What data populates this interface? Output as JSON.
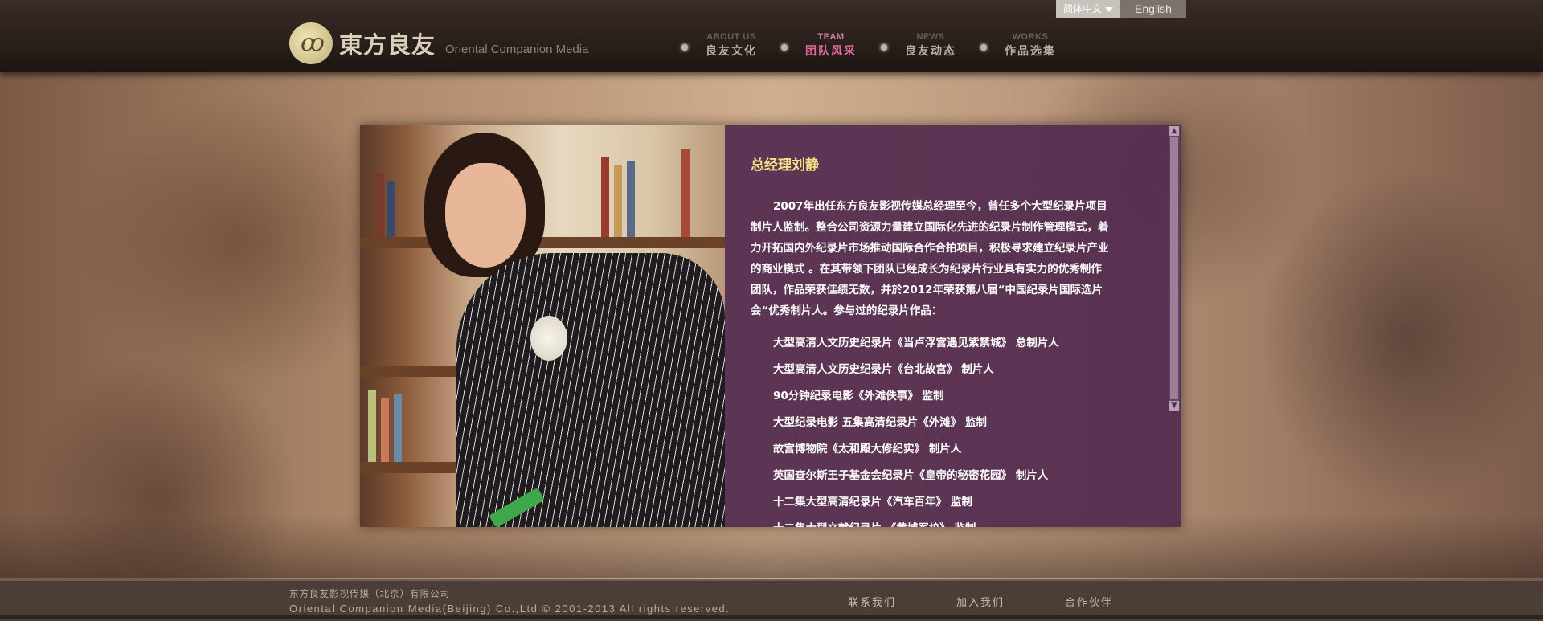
{
  "header": {
    "logo_cn": "東方良友",
    "logo_en": "Oriental Companion Media",
    "lang": {
      "chinese": "简体中文",
      "english": "English"
    },
    "nav": [
      {
        "en": "ABOUT US",
        "cn": "良友文化"
      },
      {
        "en": "TEAM",
        "cn": "团队风采"
      },
      {
        "en": "NEWS",
        "cn": "良友动态"
      },
      {
        "en": "WORKS",
        "cn": "作品选集"
      }
    ]
  },
  "profile": {
    "title": "总经理刘静",
    "intro": "2007年出任东方良友影视传媒总经理至今，曾任多个大型纪录片项目制片人监制。整合公司资源力量建立国际化先进的纪录片制作管理模式，着力开拓国内外纪录片市场推动国际合作合拍项目，积极寻求建立纪录片产业的商业模式 。在其带领下团队已经成长为纪录片行业具有实力的优秀制作团队，作品荣获佳绩无数，并於2012年荣获第八届“中国纪录片国际选片会“优秀制片人。参与过的纪录片作品：",
    "works": [
      "大型高清人文历史纪录片《当卢浮宫遇见紫禁城》 总制片人",
      "大型高清人文历史纪录片《台北故宫》 制片人",
      "90分钟纪录电影《外滩佚事》 监制",
      "大型纪录电影 五集高清纪录片《外滩》 监制",
      "故宫博物院《太和殿大修纪实》 制片人",
      "英国查尔斯王子基金会纪录片《皇帝的秘密花园》 制片人",
      "十二集大型高清纪录片《汽车百年》 监制",
      "十二集大型文献纪录片 《黄埔军校》 监制"
    ]
  },
  "footer": {
    "company_cn": "东方良友影视传媒（北京）有限公司",
    "copyright": "Oriental Companion Media(Beijing) Co.,Ltd © 2001-2013 All rights reserved.",
    "links": [
      "联系我们",
      "加入我们",
      "合作伙伴"
    ]
  },
  "colors": {
    "accent_title": "#f2e484",
    "nav_active": "#e06aa0",
    "panel_bg": "#542c50"
  }
}
